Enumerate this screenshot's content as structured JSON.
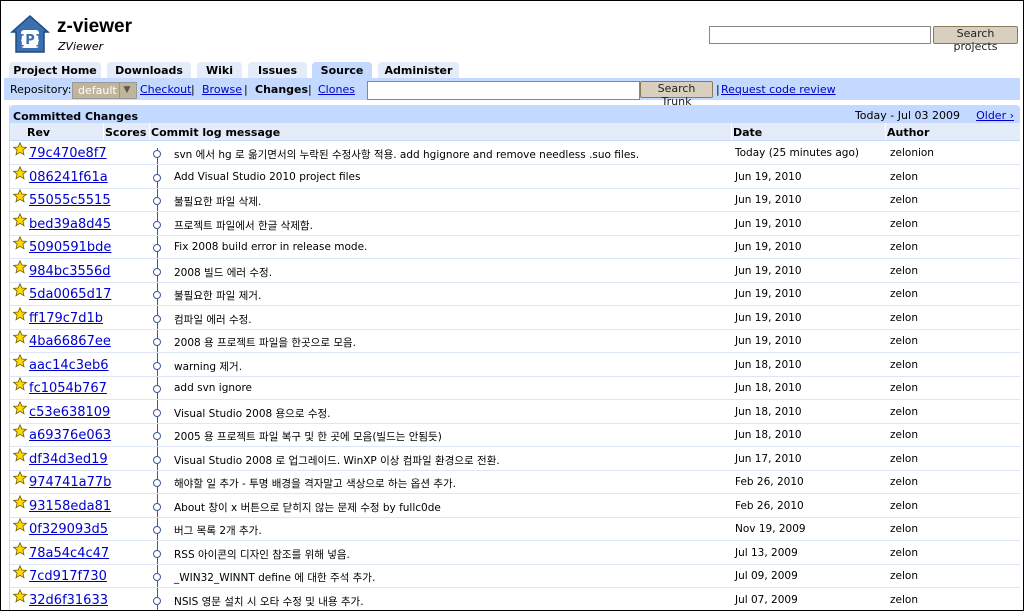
{
  "header": {
    "project_name": "z-viewer",
    "project_summary": "ZViewer",
    "search_placeholder": "",
    "search_button": "Search projects"
  },
  "tabs": [
    {
      "label": "Project Home",
      "active": false
    },
    {
      "label": "Downloads",
      "active": false
    },
    {
      "label": "Wiki",
      "active": false
    },
    {
      "label": "Issues",
      "active": false
    },
    {
      "label": "Source",
      "active": true
    },
    {
      "label": "Administer",
      "active": false
    }
  ],
  "subnav": {
    "repo_label": "Repository:",
    "repo_value": "default",
    "checkout": "Checkout",
    "browse": "Browse",
    "changes": "Changes",
    "clones": "Clones",
    "sep": "|",
    "trunk_value": "",
    "search_trunk_button": "Search Trunk",
    "request_review": "Request code review"
  },
  "changes": {
    "title": "Committed Changes",
    "range": "Today - Jul 03 2009",
    "older": "Older ›",
    "columns": {
      "rev": "Rev",
      "scores": "Scores",
      "message": "Commit log message",
      "date": "Date",
      "author": "Author"
    },
    "rows": [
      {
        "rev": "79c470e8f7",
        "msg": "svn 에서 hg 로 옮기면서의 누락된 수정사항 적용. add hgignore and remove needless .suo files.",
        "date": "Today (25 minutes ago)",
        "author": "zelonion"
      },
      {
        "rev": "086241f61a",
        "msg": "Add Visual Studio 2010 project files",
        "date": "Jun 19, 2010",
        "author": "zelon"
      },
      {
        "rev": "55055c5515",
        "msg": "불필요한 파일 삭제.",
        "date": "Jun 19, 2010",
        "author": "zelon"
      },
      {
        "rev": "bed39a8d45",
        "msg": "프로젝트 파일에서 한글 삭제함.",
        "date": "Jun 19, 2010",
        "author": "zelon"
      },
      {
        "rev": "5090591bde",
        "msg": "Fix 2008 build error in release mode.",
        "date": "Jun 19, 2010",
        "author": "zelon"
      },
      {
        "rev": "984bc3556d",
        "msg": "2008 빌드 에러 수정.",
        "date": "Jun 19, 2010",
        "author": "zelon"
      },
      {
        "rev": "5da0065d17",
        "msg": "불필요한 파일 제거.",
        "date": "Jun 19, 2010",
        "author": "zelon"
      },
      {
        "rev": "ff179c7d1b",
        "msg": "컴파일 에러 수정.",
        "date": "Jun 19, 2010",
        "author": "zelon"
      },
      {
        "rev": "4ba66867ee",
        "msg": "2008 용 프로젝트 파일을 한곳으로 모음.",
        "date": "Jun 19, 2010",
        "author": "zelon"
      },
      {
        "rev": "aac14c3eb6",
        "msg": "warning 제거.",
        "date": "Jun 18, 2010",
        "author": "zelon"
      },
      {
        "rev": "fc1054b767",
        "msg": "add svn ignore",
        "date": "Jun 18, 2010",
        "author": "zelon"
      },
      {
        "rev": "c53e638109",
        "msg": "Visual Studio 2008 용으로 수정.",
        "date": "Jun 18, 2010",
        "author": "zelon"
      },
      {
        "rev": "a69376e063",
        "msg": "2005 용 프로젝트 파일 복구 및 한 곳에 모음(빌드는 안됨듯)",
        "date": "Jun 18, 2010",
        "author": "zelon"
      },
      {
        "rev": "df34d3ed19",
        "msg": "Visual Studio 2008 로 업그레이드. WinXP 이상 컴파일 환경으로 전환.",
        "date": "Jun 17, 2010",
        "author": "zelon"
      },
      {
        "rev": "974741a77b",
        "msg": "해야할 일 추가 - 투명 배경을 격자말고 색상으로 하는 옵션 추가.",
        "date": "Feb 26, 2010",
        "author": "zelon"
      },
      {
        "rev": "93158eda81",
        "msg": "About 창이 x 버튼으로 닫히지 않는 문제 수정 by fullc0de",
        "date": "Feb 26, 2010",
        "author": "zelon"
      },
      {
        "rev": "0f329093d5",
        "msg": "버그 목록 2개 추가.",
        "date": "Nov 19, 2009",
        "author": "zelon"
      },
      {
        "rev": "78a54c4c47",
        "msg": "RSS 아이콘의 디자인 참조를 위해 넣음.",
        "date": "Jul 13, 2009",
        "author": "zelon"
      },
      {
        "rev": "7cd917f730",
        "msg": "_WIN32_WINNT define 에 대한 주석 추가.",
        "date": "Jul 09, 2009",
        "author": "zelon"
      },
      {
        "rev": "32d6f31633",
        "msg": "NSIS 영문 설치 시 오타 수정 및 내용 추가.",
        "date": "Jul 07, 2009",
        "author": "zelon"
      }
    ]
  },
  "colors": {
    "tab": "#e5ecf9",
    "tab_active": "#c3d9ff",
    "link": "#0000cc",
    "star": "#ffd800"
  }
}
